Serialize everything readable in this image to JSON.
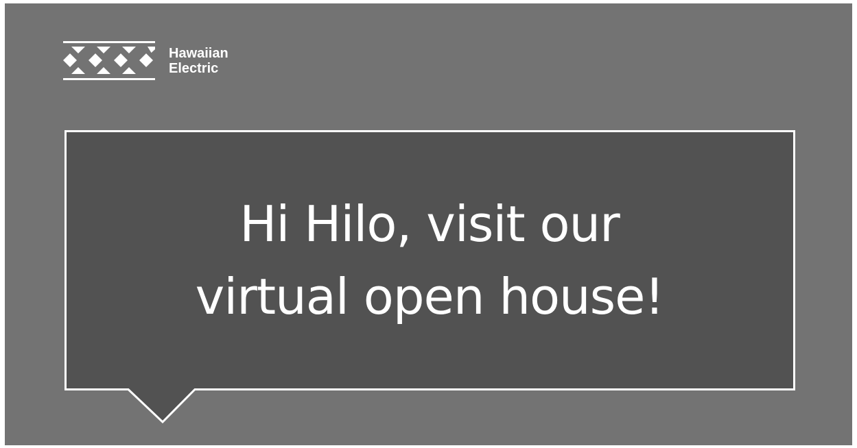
{
  "brand": {
    "name_line1": "Hawaiian",
    "name_line2": "Electric",
    "logo_icon": "hawaiian-electric-diamond-mark"
  },
  "message": {
    "line1": "Hi Hilo, visit our",
    "line2": "virtual open house!"
  },
  "colors": {
    "background": "#737373",
    "bubble_fill": "#525252",
    "bubble_stroke": "#ffffff",
    "text": "#ffffff"
  }
}
